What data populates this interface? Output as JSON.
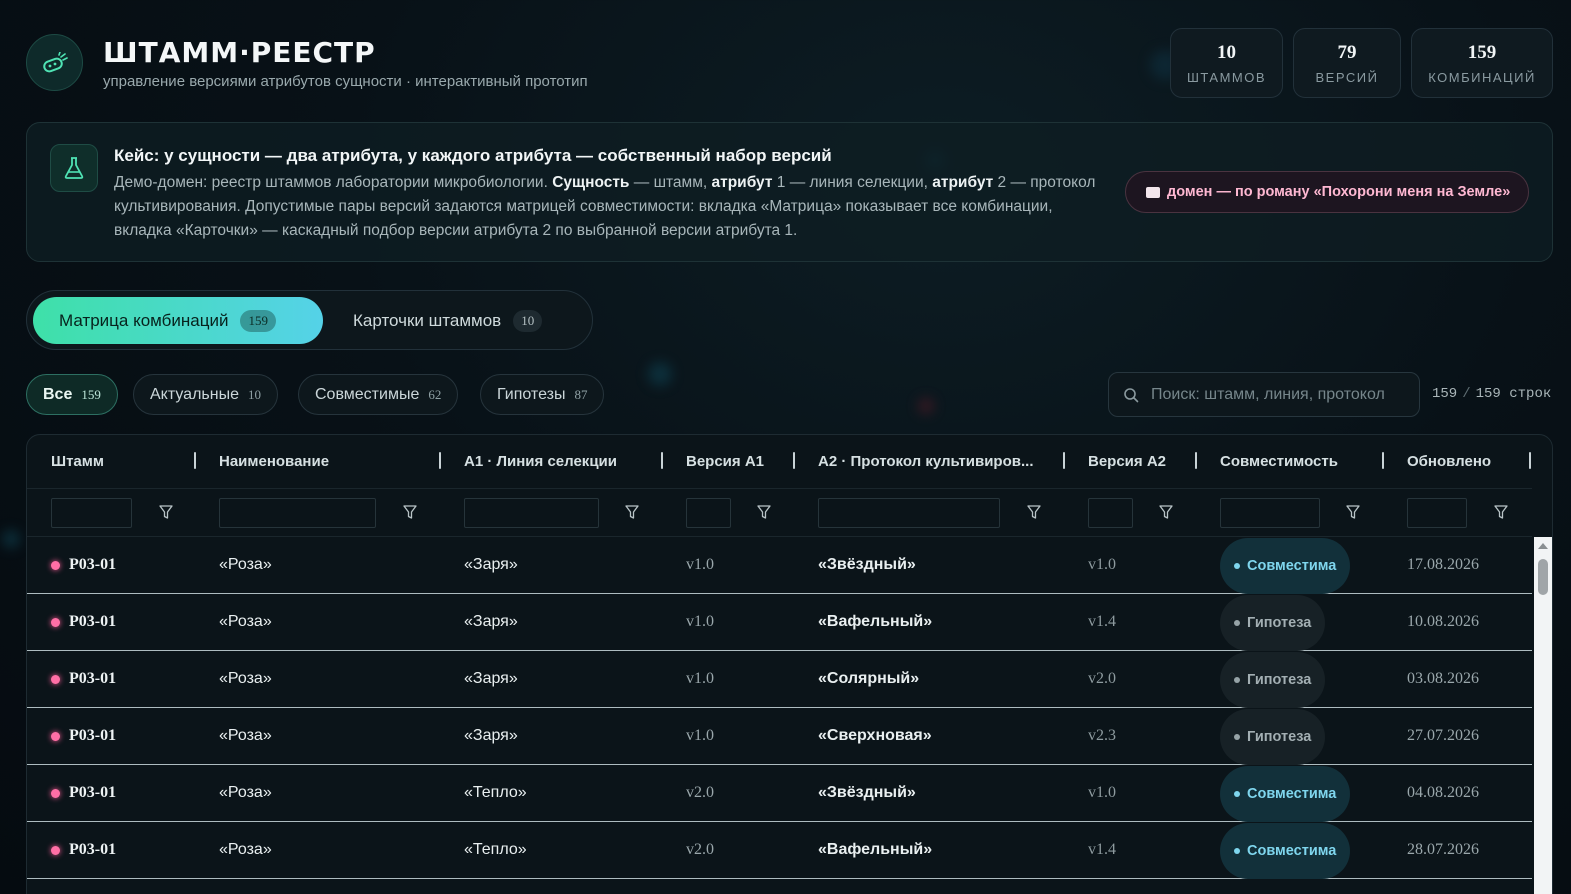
{
  "app": {
    "title": "ШТАММ·РЕЕСТР",
    "subtitle": "управление версиями атрибутов сущности · интерактивный прототип",
    "logo_icon": "bacteria-icon"
  },
  "stats": [
    {
      "value": "10",
      "label": "ШТАММОВ"
    },
    {
      "value": "79",
      "label": "ВЕРСИЙ"
    },
    {
      "value": "159",
      "label": "КОМБИНАЦИЙ"
    }
  ],
  "case": {
    "icon": "flask-icon",
    "title": "Кейс: у сущности — два атрибута, у каждого атрибута — собственный набор версий",
    "body_parts": {
      "p1": "Демо-домен: реестр штаммов лаборатории микробиологии. ",
      "b1": "Сущность",
      "p2": " — штамм, ",
      "b2": "атрибут",
      "p3": " 1 — линия селекции, ",
      "b3": "атрибут",
      "p4": " 2 — протокол культивирования. Допустимые пары версий задаются матрицей совместимости: вкладка «Матрица» показывает все комбинации, вкладка «Карточки» — каскадный подбор версии атрибута 2 по выбранной версии атрибута 1."
    },
    "domain_pill": "домен — по роману «Похорони меня на Земле»"
  },
  "tabs": [
    {
      "label": "Матрица комбинаций",
      "count": "159",
      "active": true
    },
    {
      "label": "Карточки штаммов",
      "count": "10",
      "active": false
    }
  ],
  "filters": [
    {
      "label": "Все",
      "count": "159",
      "active": true
    },
    {
      "label": "Актуальные",
      "count": "10",
      "active": false
    },
    {
      "label": "Совместимые",
      "count": "62",
      "active": false
    },
    {
      "label": "Гипотезы",
      "count": "87",
      "active": false
    }
  ],
  "search": {
    "placeholder": "Поиск: штамм, линия, протокол",
    "value": ""
  },
  "row_count": {
    "shown": "159",
    "total": "159",
    "unit": "строк"
  },
  "table": {
    "columns": [
      "Штамм",
      "Наименование",
      "A1 · Линия селекции",
      "Версия A1",
      "A2 · Протокол культивиров...",
      "Версия A2",
      "Совместимость",
      "Обновлено"
    ],
    "rows": [
      {
        "strain": "P03-01",
        "name": "«Роза»",
        "a1": "«Заря»",
        "v1": "v1.0",
        "a2": "«Звёздный»",
        "v2": "v1.0",
        "compat": "Совместима",
        "updated": "17.08.2026"
      },
      {
        "strain": "P03-01",
        "name": "«Роза»",
        "a1": "«Заря»",
        "v1": "v1.0",
        "a2": "«Вафельный»",
        "v2": "v1.4",
        "compat": "Гипотеза",
        "updated": "10.08.2026"
      },
      {
        "strain": "P03-01",
        "name": "«Роза»",
        "a1": "«Заря»",
        "v1": "v1.0",
        "a2": "«Солярный»",
        "v2": "v2.0",
        "compat": "Гипотеза",
        "updated": "03.08.2026"
      },
      {
        "strain": "P03-01",
        "name": "«Роза»",
        "a1": "«Заря»",
        "v1": "v1.0",
        "a2": "«Сверхновая»",
        "v2": "v2.3",
        "compat": "Гипотеза",
        "updated": "27.07.2026"
      },
      {
        "strain": "P03-01",
        "name": "«Роза»",
        "a1": "«Тепло»",
        "v1": "v2.0",
        "a2": "«Звёздный»",
        "v2": "v1.0",
        "compat": "Совместима",
        "updated": "04.08.2026"
      },
      {
        "strain": "P03-01",
        "name": "«Роза»",
        "a1": "«Тепло»",
        "v1": "v2.0",
        "a2": "«Вафельный»",
        "v2": "v1.4",
        "compat": "Совместима",
        "updated": "28.07.2026"
      }
    ]
  },
  "colors": {
    "accent_start": "#3ee0a8",
    "accent_end": "#55d2e8",
    "compatible": "#7fd6ee",
    "hypothesis": "#a3afb3",
    "strain_dot": "#ff6fa6"
  }
}
